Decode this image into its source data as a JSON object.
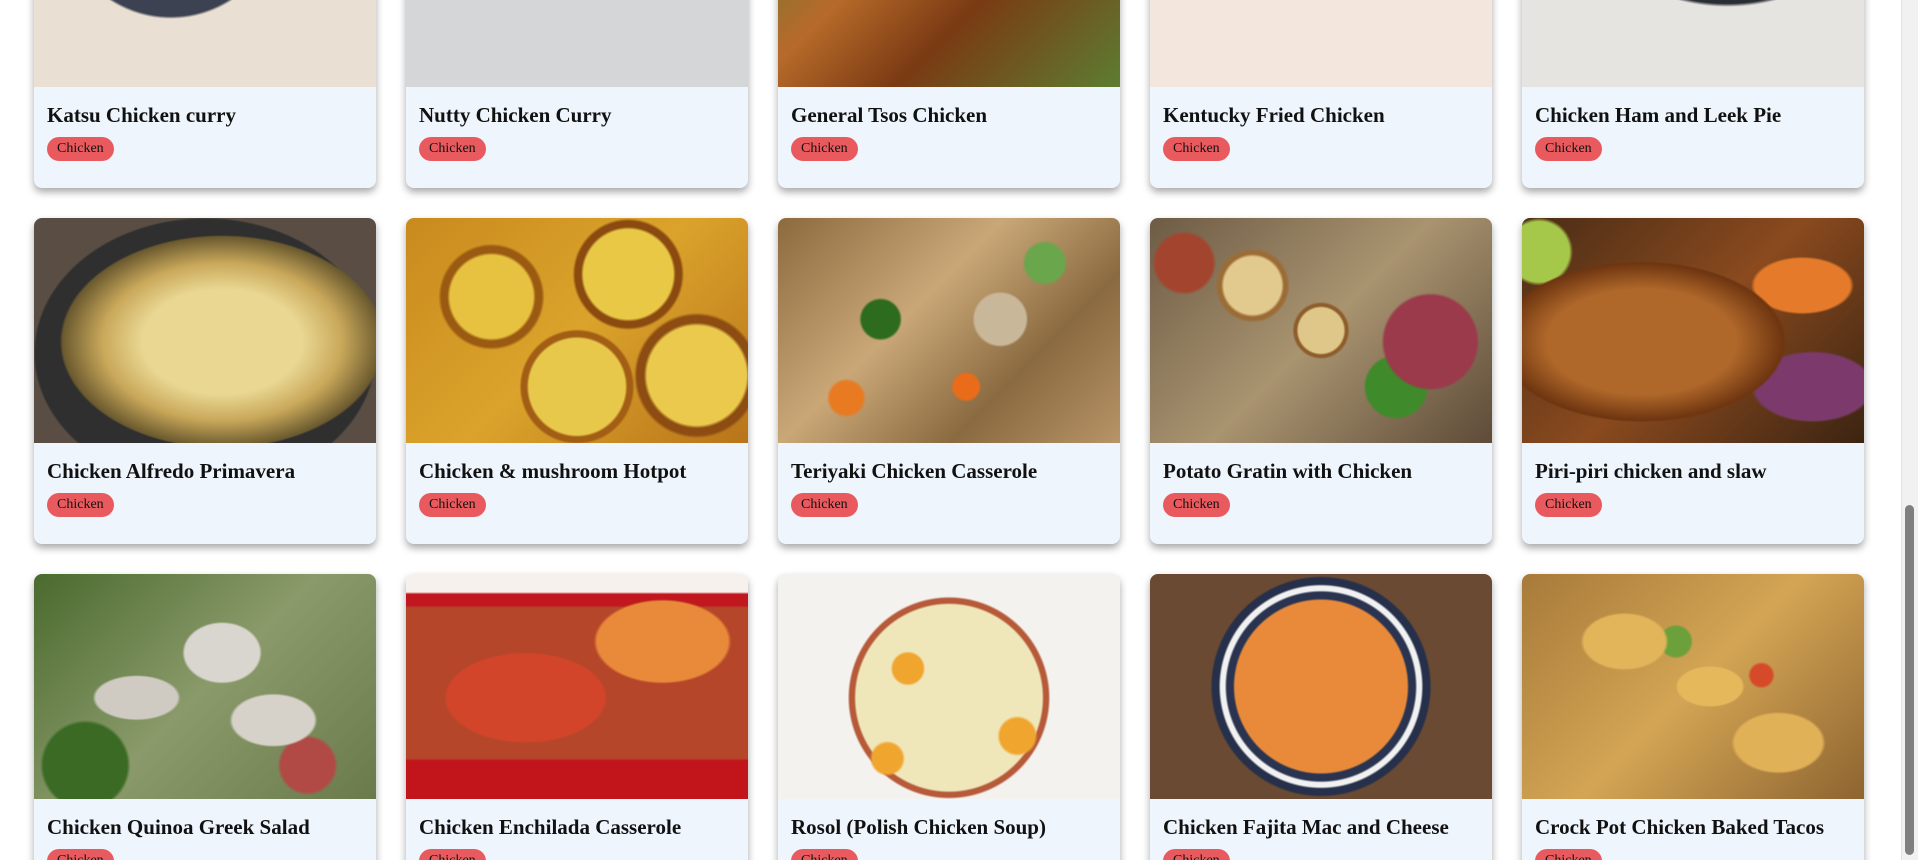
{
  "recipes": [
    {
      "title": "Katsu Chicken curry",
      "tag": "Chicken",
      "image": "katsu"
    },
    {
      "title": "Nutty Chicken Curry",
      "tag": "Chicken",
      "image": "nutty"
    },
    {
      "title": "General Tsos Chicken",
      "tag": "Chicken",
      "image": "tsos"
    },
    {
      "title": "Kentucky Fried Chicken",
      "tag": "Chicken",
      "image": "kfc"
    },
    {
      "title": "Chicken Ham and Leek Pie",
      "tag": "Chicken",
      "image": "ham"
    },
    {
      "title": "Chicken Alfredo Primavera",
      "tag": "Chicken",
      "image": "alfredo"
    },
    {
      "title": "Chicken & mushroom Hotpot",
      "tag": "Chicken",
      "image": "hotpot"
    },
    {
      "title": "Teriyaki Chicken Casserole",
      "tag": "Chicken",
      "image": "teriyaki"
    },
    {
      "title": "Potato Gratin with Chicken",
      "tag": "Chicken",
      "image": "gratin"
    },
    {
      "title": "Piri-piri chicken and slaw",
      "tag": "Chicken",
      "image": "piri"
    },
    {
      "title": "Chicken Quinoa Greek Salad",
      "tag": "Chicken",
      "image": "quinoa"
    },
    {
      "title": "Chicken Enchilada Casserole",
      "tag": "Chicken",
      "image": "enchilada"
    },
    {
      "title": "Rosol (Polish Chicken Soup)",
      "tag": "Chicken",
      "image": "rosol"
    },
    {
      "title": "Chicken Fajita Mac and Cheese",
      "tag": "Chicken",
      "image": "fajita"
    },
    {
      "title": "Crock Pot Chicken Baked Tacos",
      "tag": "Chicken",
      "image": "tacos"
    }
  ],
  "colors": {
    "card_background": "#eef5fd",
    "tag_background": "#e95a5e"
  }
}
